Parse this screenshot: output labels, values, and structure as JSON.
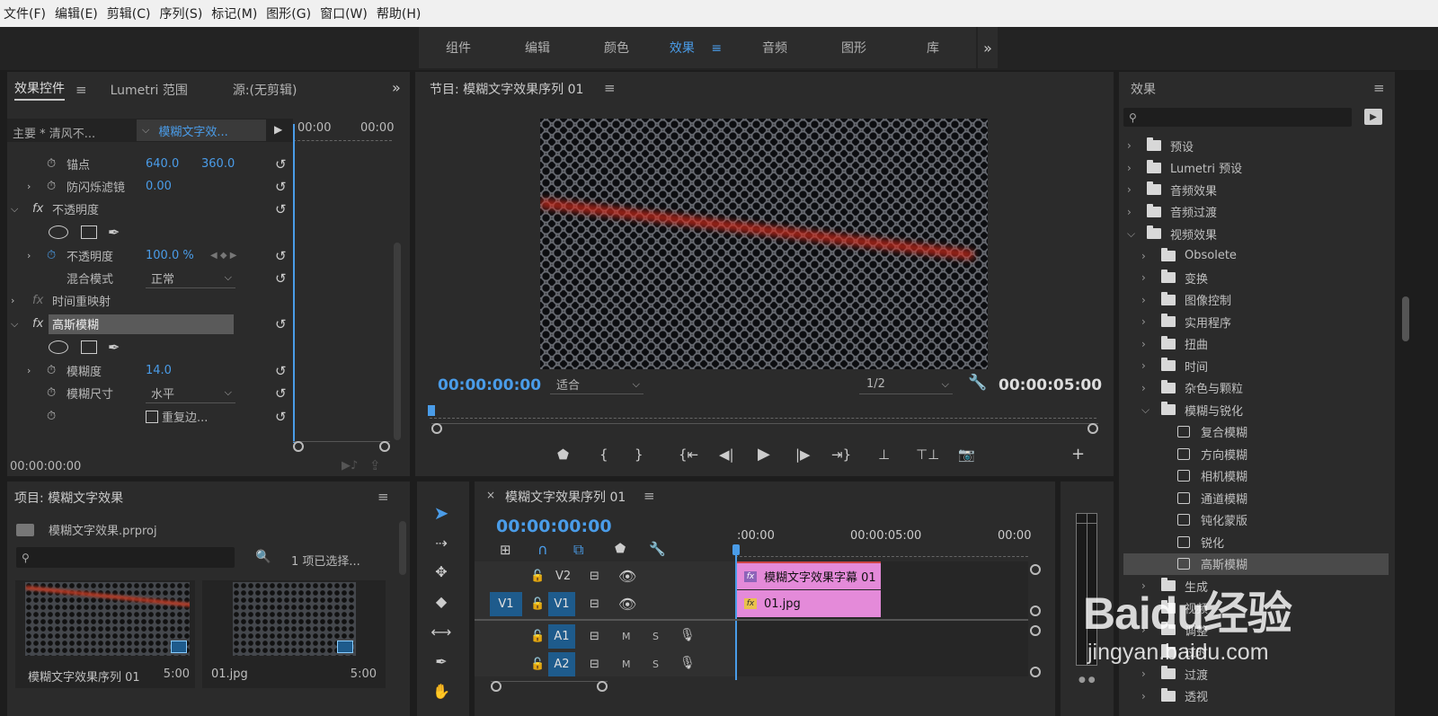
{
  "menubar": [
    "文件(F)",
    "编辑(E)",
    "剪辑(C)",
    "序列(S)",
    "标记(M)",
    "图形(G)",
    "窗口(W)",
    "帮助(H)"
  ],
  "workspaces": {
    "tabs": [
      "组件",
      "编辑",
      "颜色",
      "效果",
      "音频",
      "图形",
      "库"
    ],
    "active": "效果",
    "more": "»"
  },
  "effect_controls": {
    "tabs": [
      "效果控件",
      "Lumetri 范围",
      "源:(无剪辑)"
    ],
    "more": "»",
    "master_clip": "主要 * 清风不...",
    "sequence_clip": "模糊文字效...",
    "time_start": "00:00",
    "time_end": "00:00",
    "rows": {
      "anchor_label": "锚点",
      "anchor_x": "640.0",
      "anchor_y": "360.0",
      "flicker_label": "防闪烁滤镜",
      "flicker_val": "0.00",
      "opacity_section": "不透明度",
      "opacity_label": "不透明度",
      "opacity_val": "100.0 %",
      "blend_label": "混合模式",
      "blend_val": "正常",
      "time_remap": "时间重映射",
      "gauss_section": "高斯模糊",
      "blur_label": "模糊度",
      "blur_val": "14.0",
      "blur_dim_label": "模糊尺寸",
      "blur_dim_val": "水平",
      "repeat_edge": "重复边..."
    },
    "timecode": "00:00:00:00"
  },
  "program_monitor": {
    "title": "节目: 模糊文字效果序列 01",
    "timecode_current": "00:00:00:00",
    "fit": "适合",
    "resolution": "1/2",
    "timecode_duration": "00:00:05:00"
  },
  "effects_panel": {
    "title": "效果",
    "items": [
      {
        "label": "预设",
        "level": 0,
        "type": "preset"
      },
      {
        "label": "Lumetri 预设",
        "level": 0,
        "type": "preset"
      },
      {
        "label": "音频效果",
        "level": 0,
        "type": "folder"
      },
      {
        "label": "音频过渡",
        "level": 0,
        "type": "folder"
      },
      {
        "label": "视频效果",
        "level": 0,
        "type": "folder",
        "open": true
      },
      {
        "label": "Obsolete",
        "level": 1,
        "type": "folder"
      },
      {
        "label": "变换",
        "level": 1,
        "type": "folder"
      },
      {
        "label": "图像控制",
        "level": 1,
        "type": "folder"
      },
      {
        "label": "实用程序",
        "level": 1,
        "type": "folder"
      },
      {
        "label": "扭曲",
        "level": 1,
        "type": "folder"
      },
      {
        "label": "时间",
        "level": 1,
        "type": "folder"
      },
      {
        "label": "杂色与颗粒",
        "level": 1,
        "type": "folder"
      },
      {
        "label": "模糊与锐化",
        "level": 1,
        "type": "folder",
        "open": true
      },
      {
        "label": "复合模糊",
        "level": 2,
        "type": "fx"
      },
      {
        "label": "方向模糊",
        "level": 2,
        "type": "fx"
      },
      {
        "label": "相机模糊",
        "level": 2,
        "type": "fx"
      },
      {
        "label": "通道模糊",
        "level": 2,
        "type": "fx"
      },
      {
        "label": "钝化蒙版",
        "level": 2,
        "type": "fx"
      },
      {
        "label": "锐化",
        "level": 2,
        "type": "fx"
      },
      {
        "label": "高斯模糊",
        "level": 2,
        "type": "fx",
        "selected": true
      },
      {
        "label": "生成",
        "level": 1,
        "type": "folder"
      },
      {
        "label": "视频",
        "level": 1,
        "type": "folder"
      },
      {
        "label": "调整",
        "level": 1,
        "type": "folder"
      },
      {
        "label": "过时",
        "level": 1,
        "type": "folder"
      },
      {
        "label": "过渡",
        "level": 1,
        "type": "folder"
      },
      {
        "label": "透视",
        "level": 1,
        "type": "folder"
      }
    ]
  },
  "project": {
    "title": "项目: 模糊文字效果",
    "file": "模糊文字效果.prproj",
    "selection": "1 项已选择...",
    "bins": [
      {
        "name": "模糊文字效果序列 01",
        "duration": "5:00"
      },
      {
        "name": "01.jpg",
        "duration": "5:00"
      }
    ]
  },
  "timeline": {
    "title": "模糊文字效果序列 01",
    "close": "×",
    "timecode": "00:00:00:00",
    "ruler": [
      ":00:00",
      "00:00:05:00",
      "00:00"
    ],
    "tracks": [
      "V2",
      "V1",
      "A1",
      "A2"
    ],
    "source_patch": "V1",
    "mute": "M",
    "solo": "S",
    "clips": {
      "title_clip": "模糊文字效果字幕 01",
      "image_clip": "01.jpg"
    }
  },
  "watermark": {
    "brand": "Baidu经验",
    "url": "jingyan.baidu.com"
  },
  "colors": {
    "accent": "#4a9ce8",
    "clip": "#e48ad9",
    "track_button": "#1e5b8c",
    "panel": "#2b2b2b",
    "background": "#1d1d1d"
  }
}
